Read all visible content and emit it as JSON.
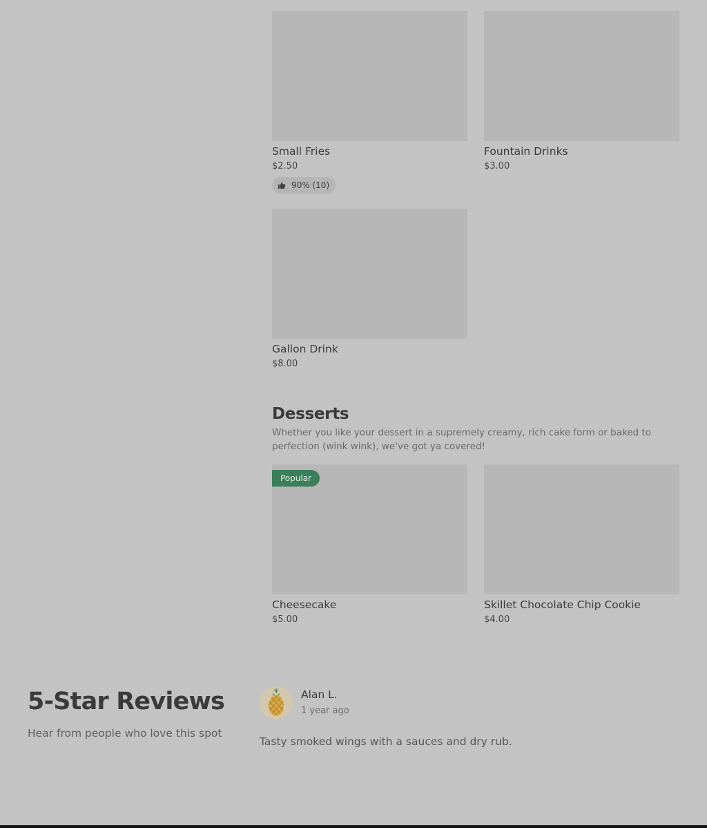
{
  "menu_items": [
    {
      "name": "Small Fries",
      "price": "$2.50",
      "rating": "90% (10)"
    },
    {
      "name": "Fountain Drinks",
      "price": "$3.00"
    },
    {
      "name": "Gallon Drink",
      "price": "$8.00"
    }
  ],
  "desserts_section": {
    "title": "Desserts",
    "description": "Whether you like your dessert in a supremely creamy, rich cake form or baked to perfection (wink wink), we've got ya covered!",
    "items": [
      {
        "name": "Cheesecake",
        "price": "$5.00",
        "badge": "Popular"
      },
      {
        "name": "Skillet Chocolate Chip Cookie",
        "price": "$4.00"
      }
    ]
  },
  "reviews": {
    "title": "5-Star Reviews",
    "subtitle": "Hear from people who love this spot",
    "items": [
      {
        "name": "Alan L.",
        "time": "1 year ago",
        "text": "Tasty smoked wings with a sauces and dry rub.",
        "avatar_icon": "pineapple-icon"
      }
    ]
  },
  "icons": {
    "rating": "thumbs-up-icon"
  },
  "colors": {
    "background": "#c3c3c3",
    "image_placeholder": "#b7b7b7",
    "popular_badge": "#3b7e5a"
  }
}
